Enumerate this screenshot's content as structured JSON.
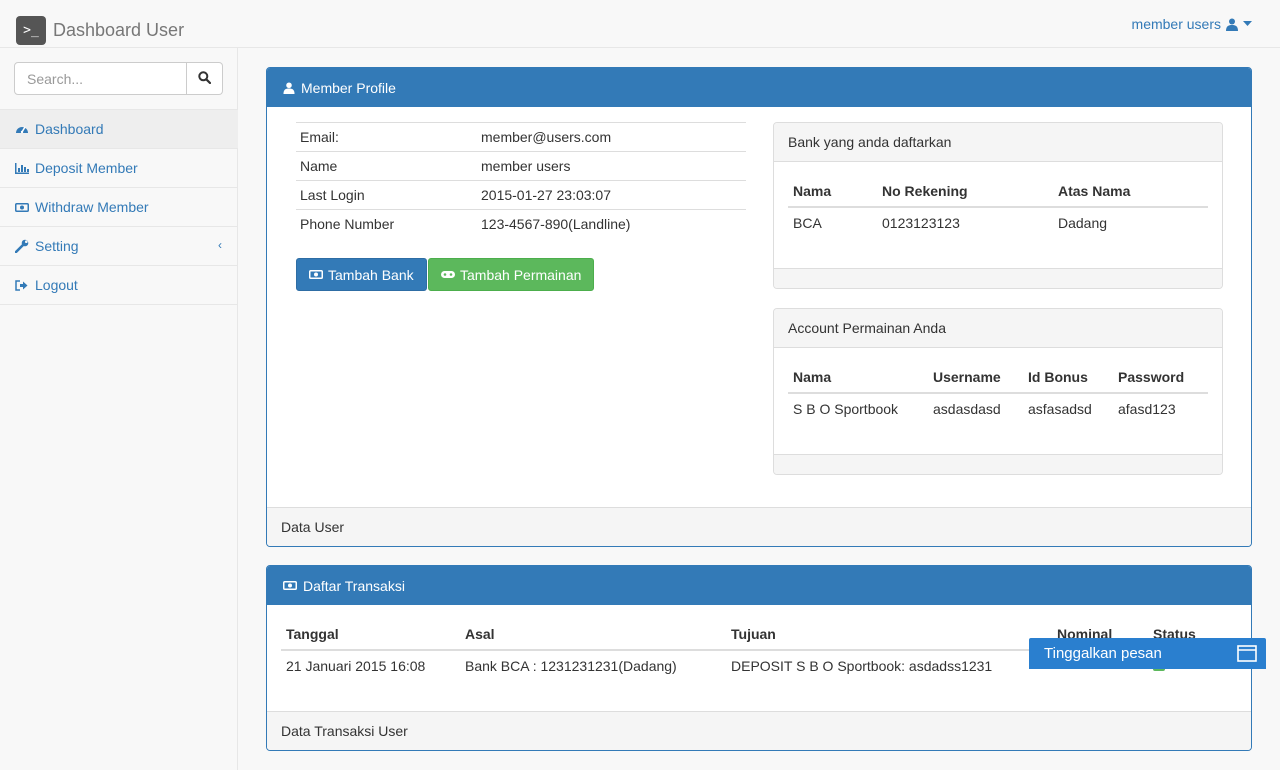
{
  "navbar": {
    "brand_logo": ">_",
    "brand_title": "Dashboard User",
    "user_label": "member users",
    "user_icon": "user-icon",
    "caret_icon": "caret-down-icon"
  },
  "sidebar": {
    "search_placeholder": "Search...",
    "search_icon": "search-icon",
    "items": [
      {
        "label": "Dashboard",
        "icon": "dashboard-icon",
        "active": true
      },
      {
        "label": "Deposit Member",
        "icon": "bar-chart-icon"
      },
      {
        "label": "Withdraw Member",
        "icon": "money-icon"
      },
      {
        "label": "Setting",
        "icon": "wrench-icon",
        "has_submenu": true
      },
      {
        "label": "Logout",
        "icon": "sign-out-icon"
      }
    ]
  },
  "profile_panel": {
    "title": "Member Profile",
    "icon": "user-icon",
    "rows": [
      {
        "label": "Email:",
        "value": "member@users.com"
      },
      {
        "label": "Name",
        "value": "member users"
      },
      {
        "label": "Last Login",
        "value": "2015-01-27 23:03:07"
      },
      {
        "label": "Phone Number",
        "value": "123-4567-890(Landline)"
      }
    ],
    "btn_tambah_bank": "Tambah Bank",
    "btn_tambah_permainan": "Tambah Permainan",
    "footer": "Data User"
  },
  "bank_panel": {
    "title": "Bank yang anda daftarkan",
    "headers": [
      "Nama",
      "No Rekening",
      "Atas Nama"
    ],
    "rows": [
      [
        "BCA",
        "0123123123",
        "Dadang"
      ]
    ]
  },
  "game_panel": {
    "title": "Account Permainan Anda",
    "headers": [
      "Nama",
      "Username",
      "Id Bonus",
      "Password"
    ],
    "rows": [
      [
        "S B O Sportbook",
        "asdasdasd",
        "asfasadsd",
        "afasd123"
      ]
    ]
  },
  "transaction_panel": {
    "title": "Daftar Transaksi",
    "icon": "money-icon",
    "headers": [
      "Tanggal",
      "Asal",
      "Tujuan",
      "Nominal",
      "Status"
    ],
    "rows": [
      [
        "21 Januari 2015 16:08",
        "Bank BCA : 1231231231(Dadang)",
        "DEPOSIT S B O Sportbook: asdadss1231",
        "",
        ""
      ]
    ],
    "footer": "Data Transaksi User"
  },
  "chat_widget": {
    "label": "Tinggalkan pesan",
    "icon": "window-icon",
    "color": "#2a7fcf"
  },
  "colors": {
    "primary": "#337ab7",
    "success": "#5cb85c"
  }
}
